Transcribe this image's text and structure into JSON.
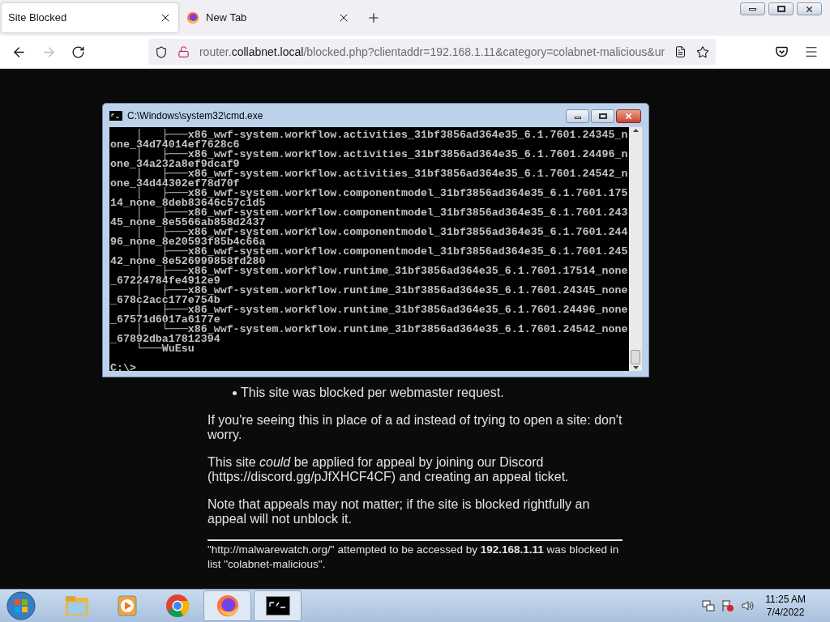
{
  "browser": {
    "tabs": [
      {
        "title": "Site Blocked",
        "selected": true,
        "favicon": false
      },
      {
        "title": "New Tab",
        "selected": false,
        "favicon": true
      }
    ],
    "nav": {
      "back_disabled": false,
      "forward_disabled": true
    },
    "url": {
      "prefix": "router.",
      "host": "collabnet.local",
      "path": "/blocked.php?clientaddr=192.168.1.11&category=colabnet-malicious&ur"
    }
  },
  "page": {
    "reasons": [
      "This site was blocked per webmaster request."
    ],
    "paragraphs": [
      "If you're seeing this in place of a ad instead of trying to open a site: don't worry.",
      "This site *could* be applied for appeal by joining our Discord (https://discord.gg/pJfXHCF4CF) and creating an appeal ticket.",
      "Note that appeals may not matter; if the site is blocked rightfully an appeal will not unblock it."
    ],
    "footer": "\"http://malwarewatch.org/\" attempted to be accessed by **192.168.1.11** was blocked in list \"colabnet-malicious\"."
  },
  "console": {
    "title": "C:\\Windows\\system32\\cmd.exe",
    "lines": [
      "    │   ├───x86_wwf-system.workflow.activities_31bf3856ad364e35_6.1.7601.24345_n",
      "one_34d74014ef7628c6",
      "    │   ├───x86_wwf-system.workflow.activities_31bf3856ad364e35_6.1.7601.24496_n",
      "one_34a232a8ef9dcaf9",
      "    │   ├───x86_wwf-system.workflow.activities_31bf3856ad364e35_6.1.7601.24542_n",
      "one_34d44302ef78d70f",
      "    │   ├───x86_wwf-system.workflow.componentmodel_31bf3856ad364e35_6.1.7601.175",
      "14_none_8deb83646c57c1d5",
      "    │   ├───x86_wwf-system.workflow.componentmodel_31bf3856ad364e35_6.1.7601.243",
      "45_none_8e5566ab858d2437",
      "    │   ├───x86_wwf-system.workflow.componentmodel_31bf3856ad364e35_6.1.7601.244",
      "96_none_8e20593f85b4c66a",
      "    │   ├───x86_wwf-system.workflow.componentmodel_31bf3856ad364e35_6.1.7601.245",
      "42_none_8e526999858fd280",
      "    │   ├───x86_wwf-system.workflow.runtime_31bf3856ad364e35_6.1.7601.17514_none",
      "_67224784fe4912e9",
      "    │   ├───x86_wwf-system.workflow.runtime_31bf3856ad364e35_6.1.7601.24345_none",
      "_678c2acc177e754b",
      "    │   ├───x86_wwf-system.workflow.runtime_31bf3856ad364e35_6.1.7601.24496_none",
      "_67571d6017a6177e",
      "    │   └───x86_wwf-system.workflow.runtime_31bf3856ad364e35_6.1.7601.24542_none",
      "_67892dba17812394",
      "    └───WuEsu"
    ],
    "prompt": "C:\\>"
  },
  "taskbar": {
    "items": [
      {
        "kind": "explorer",
        "active": false
      },
      {
        "kind": "media",
        "active": false
      },
      {
        "kind": "chrome",
        "active": false
      },
      {
        "kind": "firefox",
        "active": true
      },
      {
        "kind": "console",
        "active": true
      }
    ],
    "time": "11:25 AM",
    "date": "7/4/2022"
  }
}
